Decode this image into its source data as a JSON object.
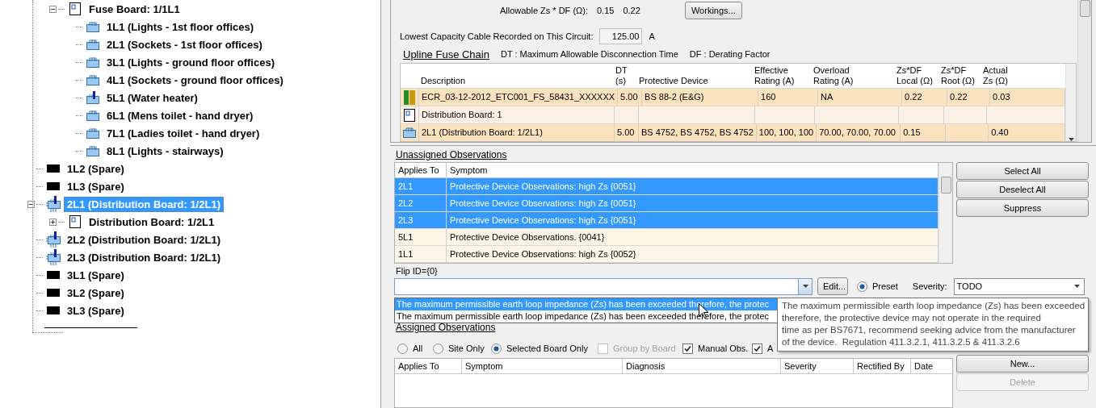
{
  "tree": {
    "items": [
      {
        "kind": "board",
        "label": "Fuse Board: 1/1L1",
        "selected": false,
        "expanded": true,
        "children": [
          {
            "kind": "circuit",
            "label": "1L1 (Lights - 1st floor offices)",
            "selected": false
          },
          {
            "kind": "circuit",
            "label": "2L1 (Sockets - 1st floor offices)",
            "selected": false
          },
          {
            "kind": "circuit",
            "label": "3L1 (Lights - ground floor offices)",
            "selected": false
          },
          {
            "kind": "circuit",
            "label": "4L1 (Sockets - ground floor offices)",
            "selected": false
          },
          {
            "kind": "switched",
            "label": "5L1 (Water heater)",
            "selected": false
          },
          {
            "kind": "circuit",
            "label": "6L1 (Mens toilet - hand dryer)",
            "selected": false
          },
          {
            "kind": "circuit",
            "label": "7L1 (Ladies toilet - hand dryer)",
            "selected": false
          },
          {
            "kind": "circuit",
            "label": "8L1 (Lights - stairways)",
            "selected": false
          }
        ]
      },
      {
        "kind": "spare",
        "label": "1L2 (Spare)",
        "selected": false
      },
      {
        "kind": "spare",
        "label": "1L3 (Spare)",
        "selected": false
      },
      {
        "kind": "feeder",
        "label": "2L1 (Distribution Board: 1/2L1)",
        "selected": true,
        "expanded": true,
        "children": [
          {
            "kind": "board",
            "label": "Distribution Board: 1/2L1",
            "selected": false,
            "expanded": false
          }
        ]
      },
      {
        "kind": "feeder",
        "label": "2L2 (Distribution Board: 1/2L1)",
        "selected": false
      },
      {
        "kind": "feeder",
        "label": "2L3 (Distribution Board: 1/2L1)",
        "selected": false
      },
      {
        "kind": "spare",
        "label": "3L1 (Spare)",
        "selected": false
      },
      {
        "kind": "spare",
        "label": "3L2 (Spare)",
        "selected": false
      },
      {
        "kind": "spare",
        "label": "3L3 (Spare)",
        "selected": false
      }
    ]
  },
  "circuit_info": {
    "allowable_label": "Allowable Zs * DF (Ω):",
    "allowable_values": [
      "0.15",
      "0.22"
    ],
    "workings_button": "Workings...",
    "lowest_label": "Lowest Capacity Cable Recorded on This Circuit:",
    "lowest_value": "125.00",
    "lowest_unit": "A"
  },
  "upline": {
    "title": "Upline Fuse Chain",
    "legend": [
      "DT : Maximum Allowable Disconnection Time",
      "DF : Derating Factor"
    ],
    "columns": [
      "Description",
      "DT\n(s)",
      "Protective Device",
      "Effective\nRating (A)",
      "Overload\nRating (A)",
      "Zs*DF\nLocal (Ω)",
      "Zs*DF\nRoot (Ω)",
      "Actual\nZs (Ω)"
    ],
    "rows": [
      {
        "kind": "fuse",
        "description": "ECR_03-12-2012_ETC001_FS_58431_XXXXXX",
        "dt": "5.00",
        "device": "BS 88-2 (E&G)",
        "effective": "160",
        "overload": "NA",
        "local": "0.22",
        "root": "0.22",
        "actual": "0.03"
      },
      {
        "kind": "board",
        "description": "Distribution Board: 1"
      },
      {
        "kind": "feeder",
        "description": "2L1 (Distribution Board: 1/2L1)",
        "dt": "5.00",
        "device": "BS 4752, BS 4752, BS 4752",
        "effective": "100, 100, 100",
        "overload": "70.00, 70.00, 70.00",
        "local": "0.15",
        "actual": "0.40"
      }
    ]
  },
  "unassigned": {
    "title": "Unassigned Observations",
    "columns": [
      "Applies To",
      "Symptom"
    ],
    "rows": [
      {
        "applies_to": "2L1",
        "symptom": "Protective Device Observations: high Zs {0051}",
        "selected": true
      },
      {
        "applies_to": "2L2",
        "symptom": "Protective Device Observations: high Zs {0051}",
        "selected": true
      },
      {
        "applies_to": "2L3",
        "symptom": "Protective Device Observations: high Zs {0051}",
        "selected": true
      },
      {
        "applies_to": "5L1",
        "symptom": "Protective Device Observations. {0041}",
        "selected": false
      },
      {
        "applies_to": "1L1",
        "symptom": "Protective Device Observations: high Zs {0052}",
        "selected": false
      }
    ],
    "buttons": [
      "Select All",
      "Deselect All",
      "Suppress"
    ]
  },
  "flip": {
    "label": "Flip ID={0}",
    "edit_button": "Edit...",
    "preset": {
      "label": "Preset",
      "selected": true
    },
    "severity_label": "Severity:",
    "severity_value": "TODO",
    "options": [
      {
        "text": "The maximum permissible earth loop impedance (Zs) has been exceeded therefore, the protec",
        "selected": true
      },
      {
        "text": "The maximum permissible earth loop impedance (Zs) has been exceeded therefore, the protec",
        "selected": false
      }
    ],
    "tooltip": "The maximum permissible earth loop impedance (Zs) has been exceeded\ntherefore, the protective device may not operate in the required\ntime as per BS7671, recommend seeking advice from the manufacturer\nof the device.  Regulation 411.3.2.1, 411.3.2.5 & 411.3.2.6"
  },
  "assigned": {
    "title": "Assigned Observations",
    "filters": [
      {
        "label": "All",
        "selected": false
      },
      {
        "label": "Site Only",
        "selected": false
      },
      {
        "label": "Selected Board Only",
        "selected": true
      }
    ],
    "checks": [
      {
        "label": "Group by Board",
        "checked": false,
        "disabled": true
      },
      {
        "label": "Manual Obs.",
        "checked": true,
        "disabled": false
      },
      {
        "label": "A",
        "checked": true,
        "disabled": false
      }
    ],
    "columns": [
      "Applies To",
      "Symptom",
      "Diagnosis",
      "Severity",
      "Rectified By",
      "Date"
    ],
    "buttons": [
      {
        "label": "New...",
        "disabled": false
      },
      {
        "label": "Delete",
        "disabled": true
      }
    ]
  }
}
